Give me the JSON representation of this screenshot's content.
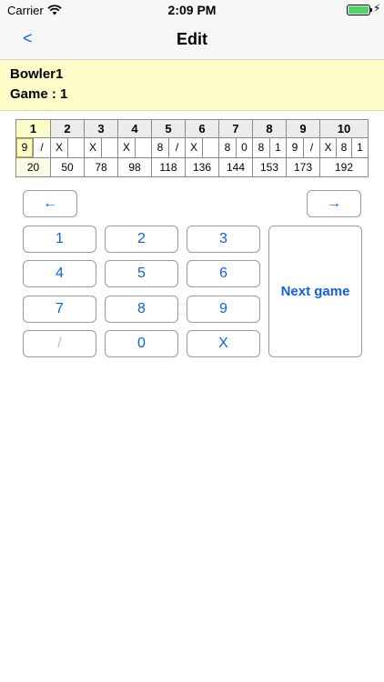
{
  "status_bar": {
    "carrier": "Carrier",
    "time": "2:09 PM",
    "battery_icon": "battery-charging-icon"
  },
  "nav": {
    "back_label": "<",
    "title": "Edit"
  },
  "info": {
    "bowler": "Bowler1",
    "game": "Game : 1"
  },
  "score_sheet": {
    "current_frame": 1,
    "frames": [
      {
        "label": "1",
        "rolls": [
          "9",
          "/"
        ],
        "score": "20"
      },
      {
        "label": "2",
        "rolls": [
          "X",
          ""
        ],
        "score": "50"
      },
      {
        "label": "3",
        "rolls": [
          "X",
          ""
        ],
        "score": "78"
      },
      {
        "label": "4",
        "rolls": [
          "X",
          ""
        ],
        "score": "98"
      },
      {
        "label": "5",
        "rolls": [
          "8",
          "/"
        ],
        "score": "118"
      },
      {
        "label": "6",
        "rolls": [
          "X",
          ""
        ],
        "score": "136"
      },
      {
        "label": "7",
        "rolls": [
          "8",
          "0"
        ],
        "score": "144"
      },
      {
        "label": "8",
        "rolls": [
          "8",
          "1"
        ],
        "score": "153"
      },
      {
        "label": "9",
        "rolls": [
          "9",
          "/"
        ],
        "score": "173"
      },
      {
        "label": "10",
        "rolls": [
          "X",
          "8",
          "1"
        ],
        "score": "192"
      }
    ]
  },
  "keypad": {
    "prev_label": "←",
    "next_label": "→",
    "keys": [
      "1",
      "2",
      "3",
      "4",
      "5",
      "6",
      "7",
      "8",
      "9",
      "/",
      "0",
      "X"
    ],
    "next_game_label": "Next game"
  },
  "colors": {
    "accent": "#1060e0",
    "highlight": "#fefcc8",
    "header_gray": "#ececec"
  }
}
